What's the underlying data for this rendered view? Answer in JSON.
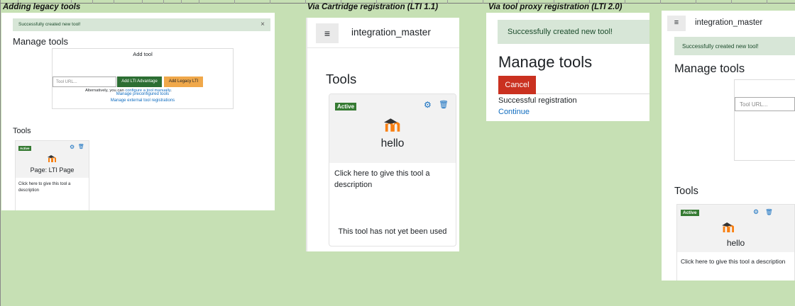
{
  "captions": {
    "legacy": "Adding legacy tools",
    "cartridge": "Via Cartridge registration (LTI 1.1)",
    "proxy": "Via tool proxy registration (LTI 2.0)"
  },
  "panel1": {
    "alert": "Successfully created new tool!",
    "alert_close": "×",
    "heading": "Manage tools",
    "add_tool_title": "Add tool",
    "url_placeholder": "Tool URL...",
    "add_lti_advantage": "Add LTI Advantage",
    "add_legacy_lti": "Add Legacy LTI",
    "alternatively_prefix": "Alternatively, you can ",
    "alternatively_link": "configure a tool manually",
    "alternatively_suffix": ".",
    "manage_preconfigured": "Manage preconfigured tools",
    "manage_external": "Manage external tool registrations",
    "tools_heading": "Tools",
    "card": {
      "badge": "Active",
      "name": "Page: LTI Page",
      "description": "Click here to give this tool a description"
    }
  },
  "panel2": {
    "menu_icon": "≡",
    "site_name": "integration_master",
    "tools_heading": "Tools",
    "card": {
      "badge": "Active",
      "name": "hello",
      "description": "Click here to give this tool a description",
      "usage": "This tool has not yet been used"
    }
  },
  "panel3": {
    "alert": "Successfully created new tool!",
    "heading": "Manage tools",
    "cancel": "Cancel",
    "status": "Successful registration",
    "continue": "Continue"
  },
  "panel4": {
    "menu_icon": "≡",
    "site_name": "integration_master",
    "alert": "Successfully created new tool!",
    "heading": "Manage tools",
    "url_placeholder": "Tool URL...",
    "tools_heading": "Tools",
    "card": {
      "badge": "Active",
      "name": "hello",
      "description": "Click here to give this tool a description"
    }
  },
  "icons": {
    "gear": "gear-icon",
    "trash": "trash-icon",
    "logo": "moodle-logo-icon",
    "menu": "hamburger-menu-icon"
  },
  "colors": {
    "background": "#c6e0b4",
    "success_alert": "#d7e6d7",
    "badge_green": "#357a32",
    "lti_advantage_button": "#2c6e33",
    "legacy_button": "#f0a84a",
    "cancel_button": "#ca3120",
    "link_blue": "#0f6cbf",
    "moodle_orange": "#f98012"
  }
}
